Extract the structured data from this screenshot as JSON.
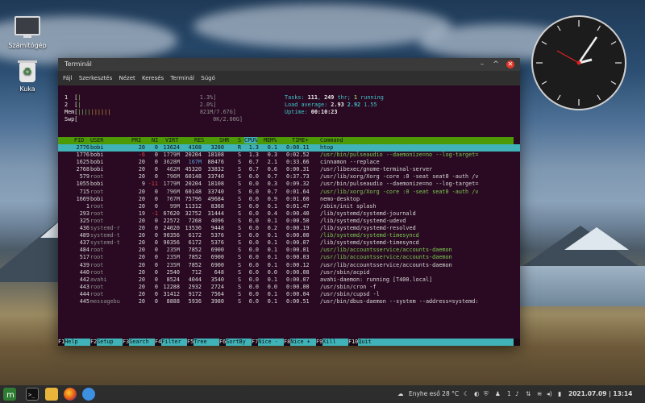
{
  "desktop": {
    "icons": [
      {
        "label": "Számítógép",
        "icon": "computer-icon"
      },
      {
        "label": "Kuka",
        "icon": "trash-icon"
      }
    ]
  },
  "window": {
    "title": "Terminál",
    "menu": [
      "Fájl",
      "Szerkesztés",
      "Nézet",
      "Keresés",
      "Terminál",
      "Súgó"
    ]
  },
  "htop": {
    "cpu1_label": "1",
    "cpu1_value": "1.3%]",
    "cpu2_label": "2",
    "cpu2_value": "2.0%]",
    "mem_label": "Mem",
    "mem_value": "821M/7.67G]",
    "swp_label": "Swp",
    "swp_value": "0K/2.00G]",
    "tasks_label": "Tasks:",
    "tasks_count": "111",
    "thr_count": "249",
    "thr_label": "thr;",
    "running_count": "1",
    "running_label": "running",
    "load_label": "Load average:",
    "load1": "2.93",
    "load5": "2.92",
    "load15": "1.55",
    "uptime_label": "Uptime:",
    "uptime_value": "00:10:23",
    "columns": [
      "PID",
      "USER",
      "PRI",
      "NI",
      "VIRT",
      "RES",
      "SHR",
      "S",
      "CPU%",
      "MEM%",
      "TIME+",
      "Command"
    ],
    "processes": [
      {
        "pid": "2776",
        "user": "bobi",
        "pri": "20",
        "ni": "0",
        "virt": "13624",
        "res": "4108",
        "shr": "3280",
        "s": "R",
        "cpu": "1.3",
        "mem": "0.1",
        "time": "0:00.11",
        "cmd": "htop",
        "color": "selected"
      },
      {
        "pid": "1776",
        "user": "bobi",
        "pri": "-6",
        "ni": "0",
        "virt": "1779M",
        "res": "20204",
        "shr": "18108",
        "s": "S",
        "cpu": "1.3",
        "mem": "0.3",
        "time": "0:02.52",
        "cmd": "/usr/bin/pulseaudio --daemonize=no --log-target=",
        "color": "green"
      },
      {
        "pid": "1625",
        "user": "bobi",
        "pri": "20",
        "ni": "0",
        "virt": "3628M",
        "res": "167M",
        "shr": "88476",
        "s": "S",
        "cpu": "0.7",
        "mem": "2.1",
        "time": "0:33.66",
        "cmd": "cinnamon --replace",
        "color": "normal"
      },
      {
        "pid": "2768",
        "user": "bobi",
        "pri": "20",
        "ni": "0",
        "virt": "462M",
        "res": "45320",
        "shr": "33832",
        "s": "S",
        "cpu": "0.7",
        "mem": "0.6",
        "time": "0:00.31",
        "cmd": "/usr/libexec/gnome-terminal-server",
        "color": "normal"
      },
      {
        "pid": "579",
        "user": "root",
        "pri": "20",
        "ni": "0",
        "virt": "796M",
        "res": "60148",
        "shr": "33740",
        "s": "S",
        "cpu": "0.0",
        "mem": "0.7",
        "time": "0:37.73",
        "cmd": "/usr/lib/xorg/Xorg -core :0 -seat seat0 -auth /v",
        "color": "normal"
      },
      {
        "pid": "1055",
        "user": "bobi",
        "pri": "9",
        "ni": "-11",
        "virt": "1779M",
        "res": "20204",
        "shr": "18108",
        "s": "S",
        "cpu": "0.0",
        "mem": "0.3",
        "time": "0:09.32",
        "cmd": "/usr/bin/pulseaudio --daemonize=no --log-target=",
        "color": "normal"
      },
      {
        "pid": "715",
        "user": "root",
        "pri": "20",
        "ni": "0",
        "virt": "796M",
        "res": "60148",
        "shr": "33740",
        "s": "S",
        "cpu": "0.0",
        "mem": "0.7",
        "time": "0:01.64",
        "cmd": "/usr/lib/xorg/Xorg -core :0 -seat seat0 -auth /v",
        "color": "green"
      },
      {
        "pid": "1669",
        "user": "bobi",
        "pri": "20",
        "ni": "0",
        "virt": "767M",
        "res": "75796",
        "shr": "49684",
        "s": "S",
        "cpu": "0.0",
        "mem": "0.9",
        "time": "0:01.60",
        "cmd": "nemo-desktop",
        "color": "normal"
      },
      {
        "pid": "1",
        "user": "root",
        "pri": "20",
        "ni": "0",
        "virt": "99M",
        "res": "11312",
        "shr": "8368",
        "s": "S",
        "cpu": "0.0",
        "mem": "0.1",
        "time": "0:01.47",
        "cmd": "/sbin/init splash",
        "color": "normal"
      },
      {
        "pid": "293",
        "user": "root",
        "pri": "19",
        "ni": "-1",
        "virt": "67620",
        "res": "32752",
        "shr": "31444",
        "s": "S",
        "cpu": "0.0",
        "mem": "0.4",
        "time": "0:00.40",
        "cmd": "/lib/systemd/systemd-journald",
        "color": "normal"
      },
      {
        "pid": "325",
        "user": "root",
        "pri": "20",
        "ni": "0",
        "virt": "22572",
        "res": "7268",
        "shr": "4096",
        "s": "S",
        "cpu": "0.0",
        "mem": "0.1",
        "time": "0:00.50",
        "cmd": "/lib/systemd/systemd-udevd",
        "color": "normal"
      },
      {
        "pid": "436",
        "user": "systemd-r",
        "pri": "20",
        "ni": "0",
        "virt": "24020",
        "res": "13536",
        "shr": "9448",
        "s": "S",
        "cpu": "0.0",
        "mem": "0.2",
        "time": "0:00.19",
        "cmd": "/lib/systemd/systemd-resolved",
        "color": "normal"
      },
      {
        "pid": "489",
        "user": "systemd-t",
        "pri": "20",
        "ni": "0",
        "virt": "90356",
        "res": "6172",
        "shr": "5376",
        "s": "S",
        "cpu": "0.0",
        "mem": "0.1",
        "time": "0:00.00",
        "cmd": "/lib/systemd/systemd-timesyncd",
        "color": "green"
      },
      {
        "pid": "437",
        "user": "systemd-t",
        "pri": "20",
        "ni": "0",
        "virt": "90356",
        "res": "6172",
        "shr": "5376",
        "s": "S",
        "cpu": "0.0",
        "mem": "0.1",
        "time": "0:00.07",
        "cmd": "/lib/systemd/systemd-timesyncd",
        "color": "normal"
      },
      {
        "pid": "484",
        "user": "root",
        "pri": "20",
        "ni": "0",
        "virt": "235M",
        "res": "7852",
        "shr": "6900",
        "s": "S",
        "cpu": "0.0",
        "mem": "0.1",
        "time": "0:00.01",
        "cmd": "/usr/lib/accountsservice/accounts-daemon",
        "color": "green"
      },
      {
        "pid": "517",
        "user": "root",
        "pri": "20",
        "ni": "0",
        "virt": "235M",
        "res": "7852",
        "shr": "6900",
        "s": "S",
        "cpu": "0.0",
        "mem": "0.1",
        "time": "0:00.03",
        "cmd": "/usr/lib/accountsservice/accounts-daemon",
        "color": "green"
      },
      {
        "pid": "439",
        "user": "root",
        "pri": "20",
        "ni": "0",
        "virt": "235M",
        "res": "7852",
        "shr": "6900",
        "s": "S",
        "cpu": "0.0",
        "mem": "0.1",
        "time": "0:00.12",
        "cmd": "/usr/lib/accountsservice/accounts-daemon",
        "color": "normal"
      },
      {
        "pid": "440",
        "user": "root",
        "pri": "20",
        "ni": "0",
        "virt": "2540",
        "res": "712",
        "shr": "648",
        "s": "S",
        "cpu": "0.0",
        "mem": "0.0",
        "time": "0:00.08",
        "cmd": "/usr/sbin/acpid",
        "color": "normal"
      },
      {
        "pid": "442",
        "user": "avahi",
        "pri": "20",
        "ni": "0",
        "virt": "8524",
        "res": "4044",
        "shr": "3540",
        "s": "S",
        "cpu": "0.0",
        "mem": "0.1",
        "time": "0:00.07",
        "cmd": "avahi-daemon: running [T400.local]",
        "color": "normal"
      },
      {
        "pid": "443",
        "user": "root",
        "pri": "20",
        "ni": "0",
        "virt": "12288",
        "res": "2932",
        "shr": "2724",
        "s": "S",
        "cpu": "0.0",
        "mem": "0.0",
        "time": "0:00.00",
        "cmd": "/usr/sbin/cron -f",
        "color": "normal"
      },
      {
        "pid": "444",
        "user": "root",
        "pri": "20",
        "ni": "0",
        "virt": "31412",
        "res": "9172",
        "shr": "7564",
        "s": "S",
        "cpu": "0.0",
        "mem": "0.1",
        "time": "0:00.04",
        "cmd": "/usr/sbin/cupsd -l",
        "color": "normal"
      },
      {
        "pid": "445",
        "user": "messagebu",
        "pri": "20",
        "ni": "0",
        "virt": "8888",
        "res": "5936",
        "shr": "3980",
        "s": "S",
        "cpu": "0.0",
        "mem": "0.1",
        "time": "0:00.51",
        "cmd": "/usr/bin/dbus-daemon --system --address=systemd:",
        "color": "normal"
      }
    ],
    "function_keys": [
      {
        "key": "F1",
        "label": "Help"
      },
      {
        "key": "F2",
        "label": "Setup"
      },
      {
        "key": "F3",
        "label": "Search"
      },
      {
        "key": "F4",
        "label": "Filter"
      },
      {
        "key": "F5",
        "label": "Tree"
      },
      {
        "key": "F6",
        "label": "SortBy"
      },
      {
        "key": "F7",
        "label": "Nice -"
      },
      {
        "key": "F8",
        "label": "Nice +"
      },
      {
        "key": "F9",
        "label": "Kill"
      },
      {
        "key": "F10",
        "label": "Quit"
      }
    ]
  },
  "panel": {
    "weather": "Enyhe eső 28 °C",
    "workspace": "1",
    "datetime": "2021.07.09 | 13:14"
  },
  "colors": {
    "terminal_bg": "#2a0a22",
    "header_green": "#4e9a06",
    "selection_cyan": "#3fb3b8",
    "text_green": "#7ccc52",
    "cpu_blue": "#5a9bd5",
    "close_red": "#e0392b"
  }
}
